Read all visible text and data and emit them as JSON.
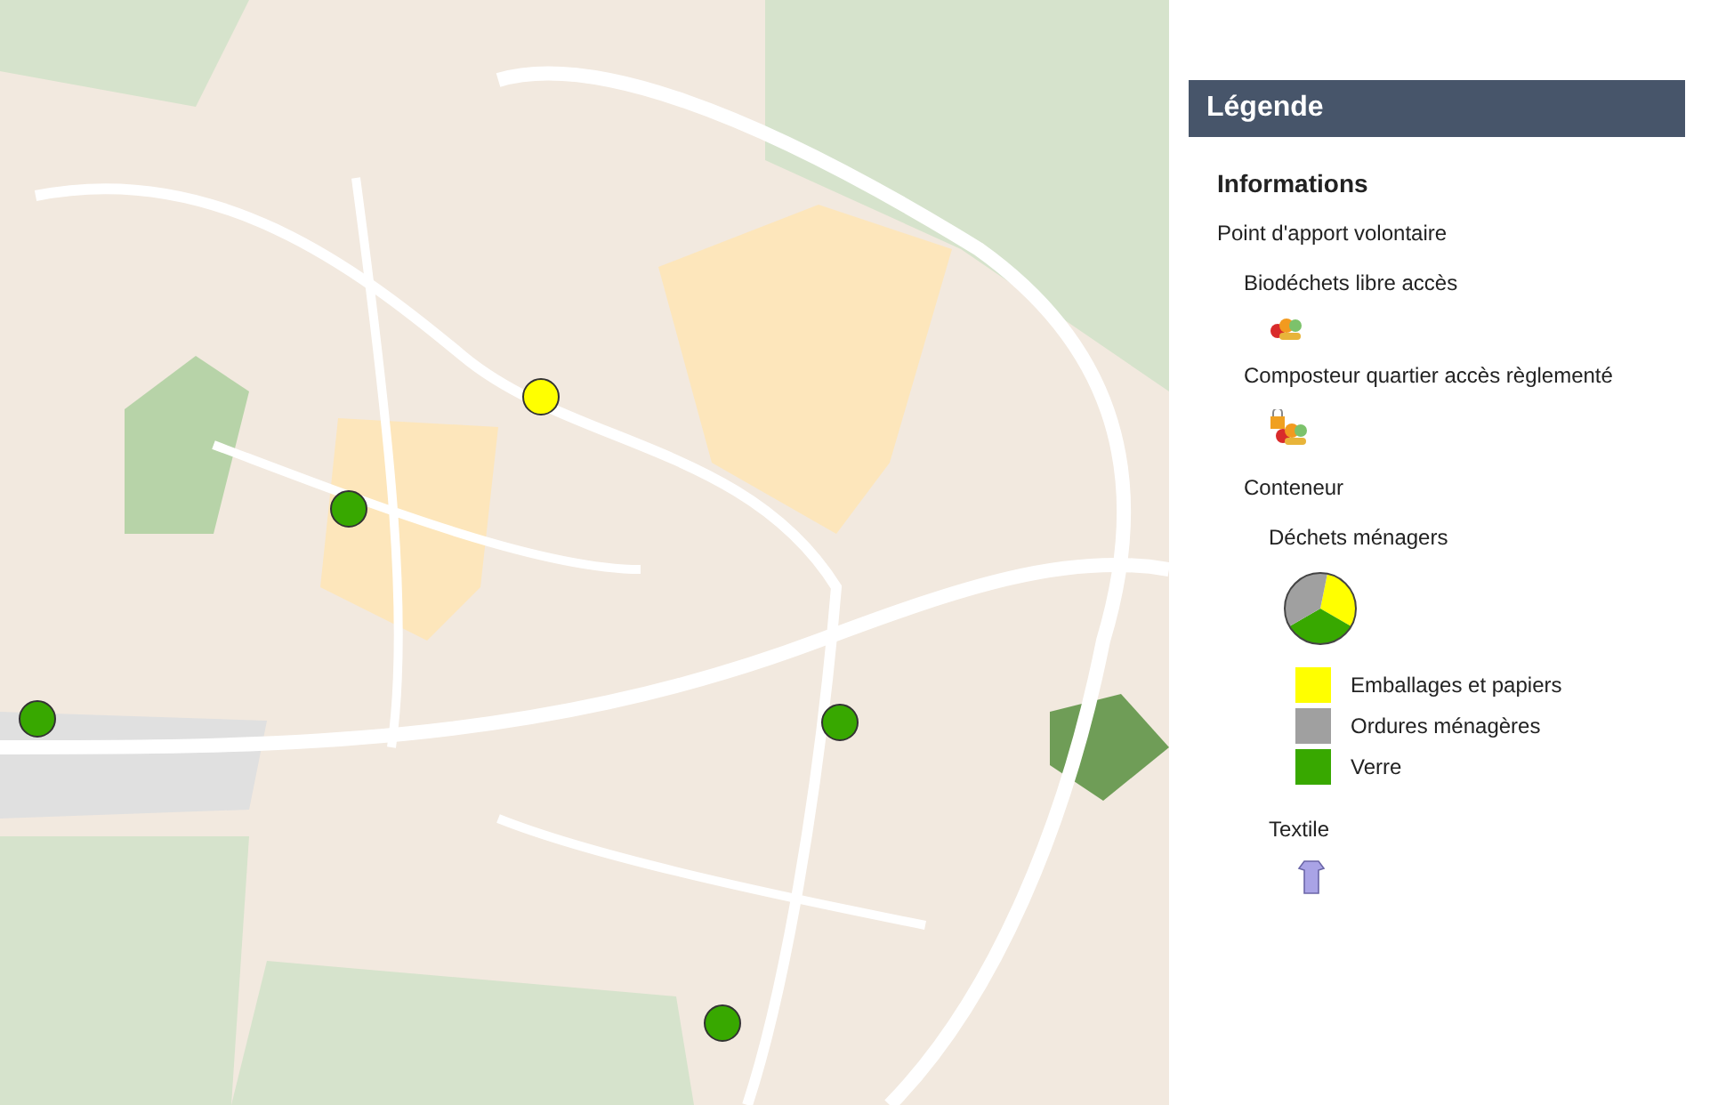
{
  "legend": {
    "title": "Légende",
    "section": "Informations",
    "group": "Point d'apport volontaire",
    "items": [
      {
        "kind": "biowaste",
        "label": "Biodéchets libre accès"
      },
      {
        "kind": "locked",
        "label": "Composteur quartier accès règlementé"
      }
    ],
    "container": {
      "label": "Conteneur",
      "household": {
        "label": "Déchets ménagers",
        "swatches": [
          {
            "label": "Emballages et papiers",
            "color": "#ffff00"
          },
          {
            "label": "Ordures ménagères",
            "color": "#a0a0a0"
          },
          {
            "label": "Verre",
            "color": "#38a800"
          }
        ]
      },
      "textile": {
        "label": "Textile"
      }
    }
  }
}
